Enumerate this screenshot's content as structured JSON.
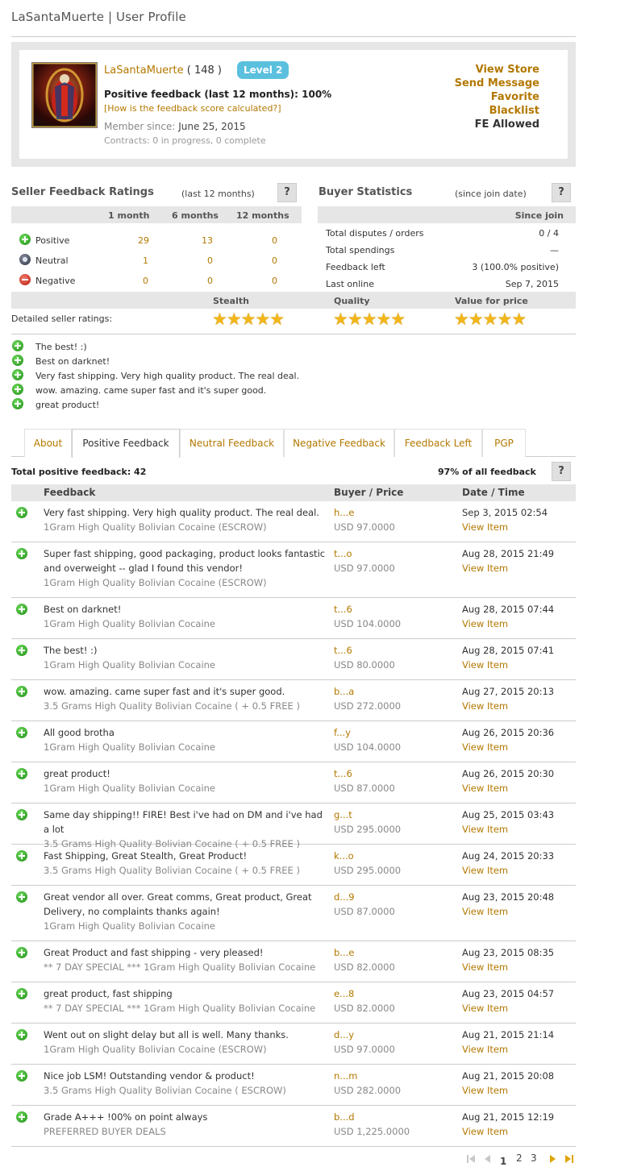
{
  "page_title": "LaSantaMuerte | User Profile",
  "profile": {
    "username": "LaSantaMuerte",
    "score": "( 148 )",
    "level": "Level 2",
    "positive_feedback": "Positive feedback (last 12 months): 100%",
    "how_link": "[How is the feedback score calculated?]",
    "member_since_label": "Member since:",
    "member_since": "June 25, 2015",
    "contracts": "Contracts: 0 in progress, 0 complete",
    "actions": [
      "View Store",
      "Send Message",
      "Favorite",
      "Blacklist"
    ],
    "fe_allowed": "FE Allowed"
  },
  "seller_ratings": {
    "title": "Seller Feedback Ratings",
    "subtitle": "(last 12 months)",
    "help": "?",
    "columns": [
      "1 month",
      "6 months",
      "12 months"
    ],
    "rows": [
      {
        "label": "Positive",
        "icon": "positive-icon",
        "values": [
          "29",
          "13",
          "0"
        ]
      },
      {
        "label": "Neutral",
        "icon": "neutral-icon",
        "values": [
          "1",
          "0",
          "0"
        ]
      },
      {
        "label": "Negative",
        "icon": "negative-icon",
        "values": [
          "0",
          "0",
          "0"
        ]
      }
    ]
  },
  "buyer_stats": {
    "title": "Buyer Statistics",
    "subtitle": "(since join date)",
    "help": "?",
    "column": "Since join",
    "rows": [
      {
        "label": "Total disputes / orders",
        "value": "0 / 4"
      },
      {
        "label": "Total spendings",
        "value": "—"
      },
      {
        "label": "Feedback left",
        "value": "3 (100.0% positive)"
      },
      {
        "label": "Last online",
        "value": "Sep 7, 2015"
      }
    ]
  },
  "detailed_ratings": {
    "label": "Detailed seller ratings:",
    "categories": [
      {
        "name": "Stealth",
        "stars": 5
      },
      {
        "name": "Quality",
        "stars": 5
      },
      {
        "name": "Value for price",
        "stars": 5
      }
    ],
    "star_glyphs": "★★★★★"
  },
  "recent_feedback": [
    "The best! :)",
    "Best on darknet!",
    "Very fast shipping. Very high quality product. The real deal.",
    "wow. amazing. came super fast and it's super good.",
    "great product!"
  ],
  "tabs": [
    "About",
    "Positive Feedback",
    "Neutral Feedback",
    "Negative Feedback",
    "Feedback Left",
    "PGP"
  ],
  "active_tab": "Positive Feedback",
  "feedback_summary": {
    "total": "Total positive feedback: 42",
    "percent": "97% of all feedback",
    "help": "?"
  },
  "feedback_table": {
    "headers": [
      "Feedback",
      "Buyer / Price",
      "Date / Time"
    ],
    "view_label": "View Item",
    "rows": [
      {
        "text": "Very fast shipping. Very high quality product. The real deal.",
        "item": "1Gram High Quality Bolivian Cocaine (ESCROW)",
        "buyer": "h...e",
        "price": "USD 97.0000",
        "date": "Sep 3, 2015 02:54"
      },
      {
        "text": "Super fast shipping, good packaging, product looks fantastic and overweight -- glad I found this vendor!",
        "item": "1Gram High Quality Bolivian Cocaine (ESCROW)",
        "buyer": "t...o",
        "price": "USD 97.0000",
        "date": "Aug 28, 2015 21:49"
      },
      {
        "text": "Best on darknet!",
        "item": "1Gram High Quality Bolivian Cocaine",
        "buyer": "t...6",
        "price": "USD 104.0000",
        "date": "Aug 28, 2015 07:44"
      },
      {
        "text": "The best! :)",
        "item": "1Gram High Quality Bolivian Cocaine",
        "buyer": "t...6",
        "price": "USD 80.0000",
        "date": "Aug 28, 2015 07:41"
      },
      {
        "text": "wow. amazing. came super fast and it's super good.",
        "item": "3.5 Grams High Quality Bolivian Cocaine ( + 0.5 FREE )",
        "buyer": "b...a",
        "price": "USD 272.0000",
        "date": "Aug 27, 2015 20:13"
      },
      {
        "text": "All good brotha",
        "item": "1Gram High Quality Bolivian Cocaine",
        "buyer": "f...y",
        "price": "USD 104.0000",
        "date": "Aug 26, 2015 20:36"
      },
      {
        "text": "great product!",
        "item": "1Gram High Quality Bolivian Cocaine",
        "buyer": "t...6",
        "price": "USD 87.0000",
        "date": "Aug 26, 2015 20:30"
      },
      {
        "text": "Same day shipping!! FIRE! Best i've had on DM and i've had a lot",
        "item": "3.5 Grams High Quality Bolivian Cocaine ( + 0.5 FREE )",
        "buyer": "g...t",
        "price": "USD 295.0000",
        "date": "Aug 25, 2015 03:43"
      },
      {
        "text": "Fast Shipping, Great Stealth, Great Product!",
        "item": "3.5 Grams High Quality Bolivian Cocaine ( + 0.5 FREE )",
        "buyer": "k...o",
        "price": "USD 295.0000",
        "date": "Aug 24, 2015 20:33"
      },
      {
        "text": "Great vendor all over. Great comms, Great product, Great Delivery, no complaints thanks again!",
        "item": "1Gram High Quality Bolivian Cocaine",
        "buyer": "d...9",
        "price": "USD 87.0000",
        "date": "Aug 23, 2015 20:48"
      },
      {
        "text": "Great Product and fast shipping - very pleased!",
        "item": "** 7 DAY SPECIAL *** 1Gram High Quality Bolivian Cocaine",
        "buyer": "b...e",
        "price": "USD 82.0000",
        "date": "Aug 23, 2015 08:35"
      },
      {
        "text": "great product, fast shipping",
        "item": "** 7 DAY SPECIAL *** 1Gram High Quality Bolivian Cocaine",
        "buyer": "e...8",
        "price": "USD 82.0000",
        "date": "Aug 23, 2015 04:57"
      },
      {
        "text": "Went out on slight delay but all is well. Many thanks.",
        "item": "1Gram High Quality Bolivian Cocaine (ESCROW)",
        "buyer": "d...y",
        "price": "USD 97.0000",
        "date": "Aug 21, 2015 21:14"
      },
      {
        "text": "Nice job LSM! Outstanding vendor & product!",
        "item": "3.5 Grams High Quality Bolivian Cocaine ( ESCROW)",
        "buyer": "n...m",
        "price": "USD 282.0000",
        "date": "Aug 21, 2015 20:08"
      },
      {
        "text": "Grade A+++ !00% on point always",
        "item": "PREFERRED BUYER DEALS",
        "buyer": "b...d",
        "price": "USD 1,225.0000",
        "date": "Aug 21, 2015 12:19"
      }
    ]
  },
  "pagination": {
    "pages": [
      "1",
      "2",
      "3"
    ],
    "current": "1",
    "icons": [
      "first-page-icon",
      "prev-page-icon",
      "next-page-icon",
      "last-page-icon"
    ]
  },
  "colors": {
    "accent": "#b37800",
    "level_badge": "#5bc0de",
    "positive": "#2a9a22",
    "negative": "#c0281a"
  }
}
